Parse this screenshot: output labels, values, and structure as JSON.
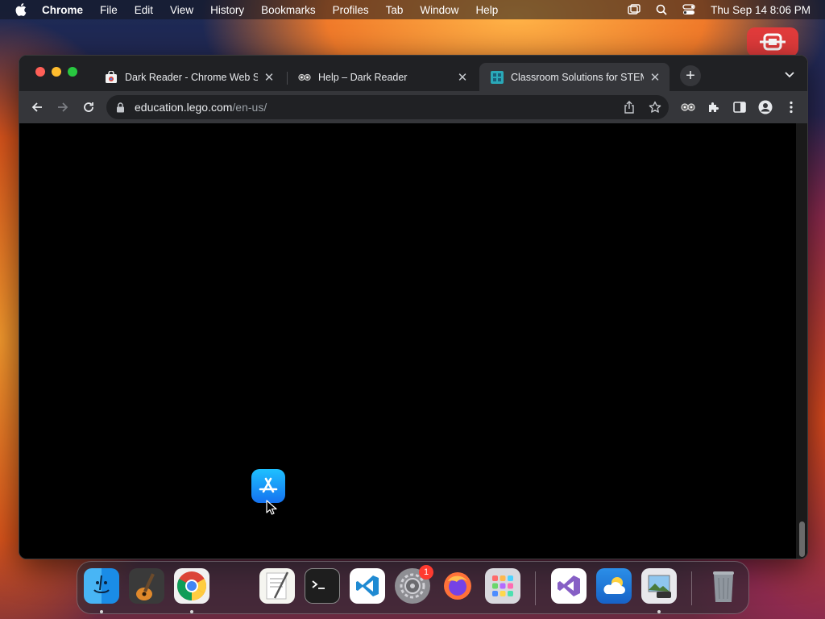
{
  "menubar": {
    "app_name": "Chrome",
    "items": [
      "File",
      "Edit",
      "View",
      "History",
      "Bookmarks",
      "Profiles",
      "Tab",
      "Window",
      "Help"
    ],
    "clock": "Thu Sep 14  8:06 PM"
  },
  "tabs": [
    {
      "title": "Dark Reader - Chrome Web Store",
      "favicon": "chrome-web-store-icon",
      "active": false
    },
    {
      "title": "Help – Dark Reader",
      "favicon": "dark-reader-icon",
      "active": false
    },
    {
      "title": "Classroom Solutions for STEM",
      "favicon": "lego-education-icon",
      "active": true
    }
  ],
  "address_bar": {
    "host": "education.lego.com",
    "path": "/en-us/"
  },
  "dock": {
    "apps": [
      "Finder",
      "GarageBand",
      "Google Chrome",
      "TextEdit",
      "Terminal",
      "Visual Studio Code",
      "System Settings",
      "Firefox",
      "Launchpad",
      "Visual Studio",
      "Weather",
      "Preview",
      "Trash"
    ],
    "settings_badge": "1"
  },
  "colors": {
    "tab_bar": "#202124",
    "toolbar": "#35363a",
    "content": "#000000",
    "accent": "#1a73e8"
  }
}
